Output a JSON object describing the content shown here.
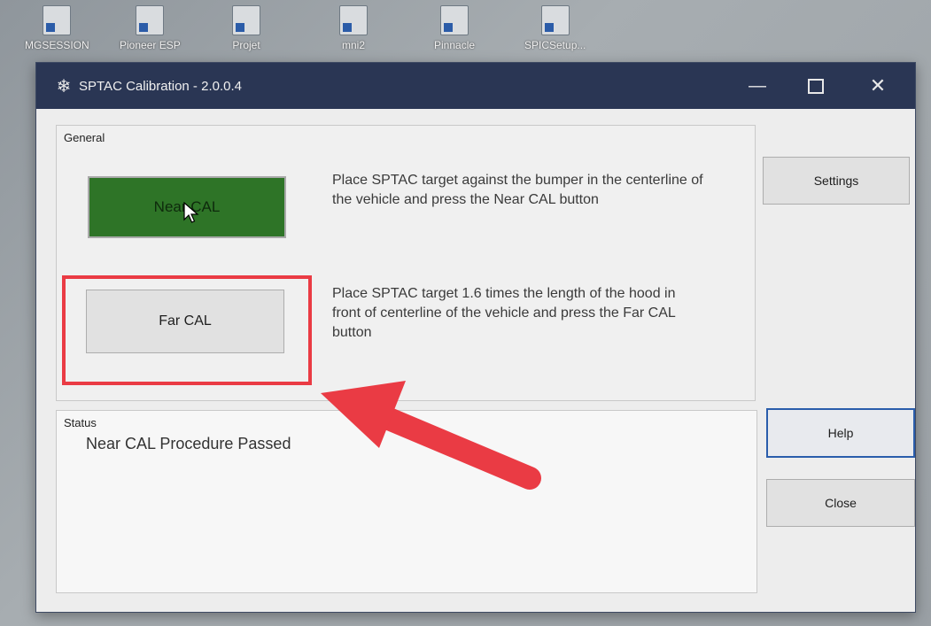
{
  "desktop": {
    "icons": [
      {
        "label": "MGSESSION",
        "icon": "shortcut-icon"
      },
      {
        "label": "Pioneer ESP",
        "icon": "excel-icon"
      },
      {
        "label": "Projet",
        "icon": "shortcut-icon"
      },
      {
        "label": "mni2",
        "icon": "shortcut-icon"
      },
      {
        "label": "Pinnacle",
        "icon": "app-icon"
      },
      {
        "label": "SPICSetup...",
        "icon": "installer-icon"
      }
    ]
  },
  "window": {
    "title": "SPTAC Calibration - 2.0.0.4",
    "icon": "snowflake-icon"
  },
  "general": {
    "label": "General",
    "near_button": "Near CAL",
    "near_description": "Place SPTAC target against the bumper in the centerline of the vehicle and press the Near CAL button",
    "far_button": "Far CAL",
    "far_description": "Place SPTAC target 1.6 times the length of the hood in front of centerline of the vehicle and press the Far CAL button"
  },
  "status": {
    "label": "Status",
    "message": "Near CAL Procedure Passed"
  },
  "side_buttons": {
    "settings": "Settings",
    "help": "Help",
    "close": "Close"
  },
  "colors": {
    "titlebar": "#2a3654",
    "near_button": "#2e7427",
    "annotation": "#ea3b44",
    "help_focus": "#2a5dab"
  }
}
